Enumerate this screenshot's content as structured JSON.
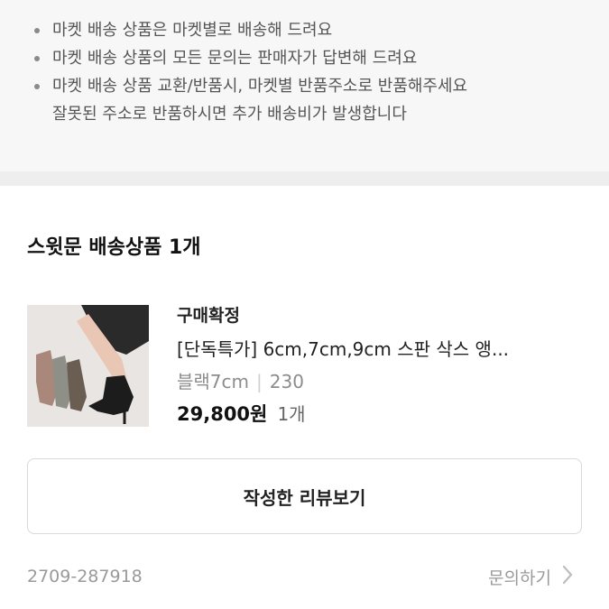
{
  "notice": {
    "items": [
      {
        "line1": "마켓 배송 상품은 마켓별로 배송해 드려요",
        "line2": ""
      },
      {
        "line1": "마켓 배송 상품의 모든 문의는 판매자가 답변해 드려요",
        "line2": ""
      },
      {
        "line1": "마켓 배송 상품 교환/반품시, 마켓별 반품주소로 반품해주세요",
        "line2": "잘못된 주소로 반품하시면 추가 배송비가 발생합니다"
      }
    ]
  },
  "section": {
    "title": "스윗문 배송상품 1개"
  },
  "product": {
    "status": "구매확정",
    "name": "[단독특가] 6cm,7cm,9cm 스판 삭스 앵...",
    "option_color": "블랙7cm",
    "option_separator": "|",
    "option_size": "230",
    "price": "29,800원",
    "quantity": "1개",
    "image_icon": "product-image"
  },
  "actions": {
    "review_button": "작성한 리뷰보기",
    "inquiry_label": "문의하기",
    "inquiry_icon": "chevron-right-icon"
  },
  "order": {
    "number": "2709-287918"
  },
  "colors": {
    "notice_bg": "#f7f7f7",
    "divider": "#eeeeee",
    "muted_text": "#9a9a9a"
  }
}
